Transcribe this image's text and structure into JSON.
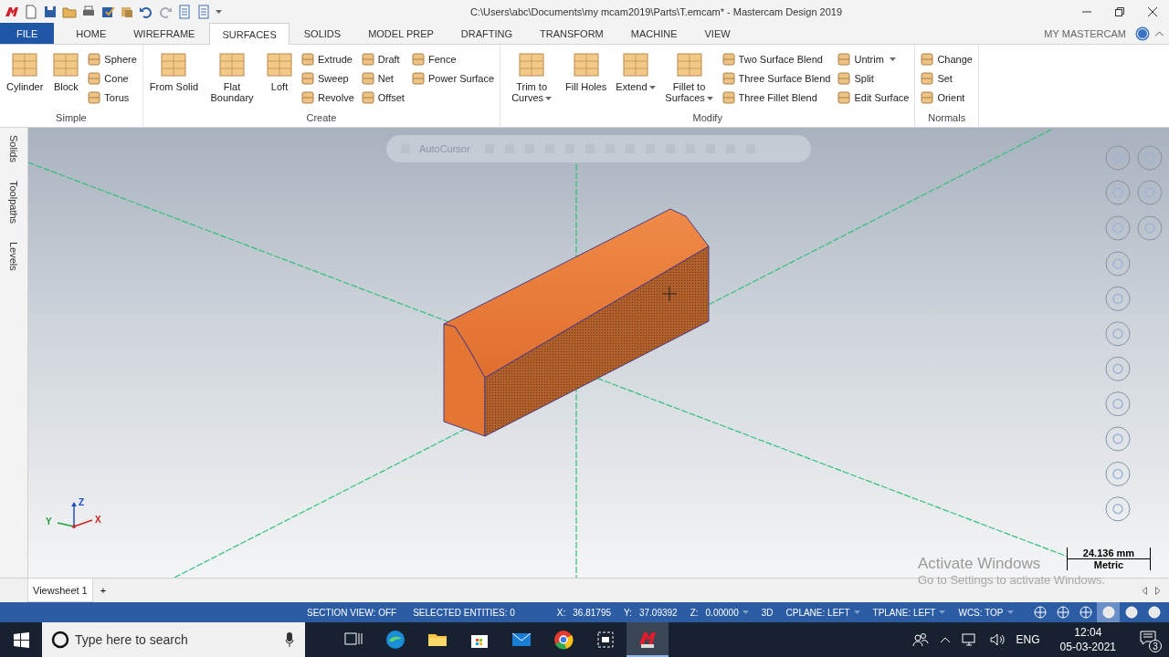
{
  "window": {
    "title": "C:\\Users\\abc\\Documents\\my mcam2019\\Parts\\T.emcam* - Mastercam Design 2019"
  },
  "ribbon": {
    "tabs": [
      {
        "label": "FILE",
        "kind": "file",
        "selected": false
      },
      {
        "label": "HOME",
        "kind": "tab",
        "selected": false
      },
      {
        "label": "WIREFRAME",
        "kind": "tab",
        "selected": false
      },
      {
        "label": "SURFACES",
        "kind": "tab",
        "selected": true
      },
      {
        "label": "SOLIDS",
        "kind": "tab",
        "selected": false
      },
      {
        "label": "MODEL PREP",
        "kind": "tab",
        "selected": false
      },
      {
        "label": "DRAFTING",
        "kind": "tab",
        "selected": false
      },
      {
        "label": "TRANSFORM",
        "kind": "tab",
        "selected": false
      },
      {
        "label": "MACHINE",
        "kind": "tab",
        "selected": false
      },
      {
        "label": "VIEW",
        "kind": "tab",
        "selected": false
      }
    ],
    "account": "MY MASTERCAM",
    "groups": [
      {
        "label": "Simple",
        "columns": [
          {
            "kind": "large",
            "label": "Cylinder",
            "menu": false
          },
          {
            "kind": "large",
            "label": "Block",
            "menu": false
          },
          {
            "kind": "stack",
            "items": [
              {
                "label": "Sphere",
                "menu": false
              },
              {
                "label": "Cone",
                "menu": false
              },
              {
                "label": "Torus",
                "menu": false
              }
            ]
          }
        ]
      },
      {
        "label": "Create",
        "columns": [
          {
            "kind": "large",
            "label": "From Solid",
            "menu": false
          },
          {
            "kind": "large",
            "label": "Flat Boundary",
            "menu": false
          },
          {
            "kind": "large",
            "label": "Loft",
            "menu": false
          },
          {
            "kind": "stack",
            "items": [
              {
                "label": "Extrude",
                "menu": false
              },
              {
                "label": "Sweep",
                "menu": false
              },
              {
                "label": "Revolve",
                "menu": false
              }
            ]
          },
          {
            "kind": "stack",
            "items": [
              {
                "label": "Draft",
                "menu": false
              },
              {
                "label": "Net",
                "menu": false
              },
              {
                "label": "Offset",
                "menu": false
              }
            ]
          },
          {
            "kind": "stack",
            "items": [
              {
                "label": "Fence",
                "menu": false
              },
              {
                "label": "Power Surface",
                "menu": false
              }
            ]
          }
        ]
      },
      {
        "label": "Modify",
        "columns": [
          {
            "kind": "large",
            "label": "Trim to Curves",
            "menu": true
          },
          {
            "kind": "large",
            "label": "Fill Holes",
            "menu": false
          },
          {
            "kind": "large",
            "label": "Extend",
            "menu": true
          },
          {
            "kind": "large",
            "label": "Fillet to Surfaces",
            "menu": true
          },
          {
            "kind": "stack",
            "items": [
              {
                "label": "Two Surface Blend",
                "menu": false
              },
              {
                "label": "Three Surface Blend",
                "menu": false
              },
              {
                "label": "Three Fillet Blend",
                "menu": false
              }
            ]
          },
          {
            "kind": "stack",
            "items": [
              {
                "label": "Untrim",
                "menu": true
              },
              {
                "label": "Split",
                "menu": false
              },
              {
                "label": "Edit Surface",
                "menu": false
              }
            ]
          }
        ]
      },
      {
        "label": "Normals",
        "columns": [
          {
            "kind": "stack",
            "items": [
              {
                "label": "Change",
                "menu": false
              },
              {
                "label": "Set",
                "menu": false
              },
              {
                "label": "Orient",
                "menu": false
              }
            ]
          }
        ]
      }
    ]
  },
  "side_panel_tabs": [
    "Solids",
    "Toolpaths",
    "Levels"
  ],
  "viewport": {
    "selection_bar": {
      "label": "AutoCursor"
    },
    "axis_labels": [
      "Z",
      "Y",
      "X"
    ],
    "scale": {
      "value": "24.136 mm",
      "unit": "Metric"
    }
  },
  "viewsheets": {
    "tabs": [
      {
        "label": "Viewsheet 1",
        "selected": true
      }
    ],
    "add": "+"
  },
  "activation_notice": {
    "title": "Activate Windows",
    "message": "Go to Settings to activate Windows."
  },
  "status_bar": {
    "left": [
      "SECTION VIEW: OFF",
      "SELECTED ENTITIES: 0"
    ],
    "readouts": [
      {
        "label": "X:",
        "value": "36.81795",
        "menu": false
      },
      {
        "label": "Y:",
        "value": "37.09392",
        "menu": false
      },
      {
        "label": "Z:",
        "value": "0.00000",
        "menu": true
      },
      {
        "label": "3D",
        "menu": false
      },
      {
        "label": "CPLANE: LEFT",
        "menu": true
      },
      {
        "label": "TPLANE: LEFT",
        "menu": true
      },
      {
        "label": "WCS: TOP",
        "menu": true
      }
    ],
    "display_modes": [
      {
        "selected": false
      },
      {
        "selected": false
      },
      {
        "selected": false
      },
      {
        "selected": true
      },
      {
        "selected": false
      },
      {
        "selected": false
      }
    ]
  },
  "taskbar": {
    "search": {
      "placeholder": "Type here to search"
    },
    "apps": [
      {
        "kind": "taskview",
        "selected": false
      },
      {
        "kind": "edge",
        "selected": false
      },
      {
        "kind": "explorer",
        "selected": false
      },
      {
        "kind": "store",
        "selected": false
      },
      {
        "kind": "mail",
        "selected": false
      },
      {
        "kind": "chrome",
        "selected": false
      },
      {
        "kind": "snip",
        "selected": false
      },
      {
        "kind": "mastercam",
        "selected": true
      }
    ],
    "language": "ENG",
    "time": "12:04",
    "date": "05-03-2021",
    "notifications": "3"
  }
}
